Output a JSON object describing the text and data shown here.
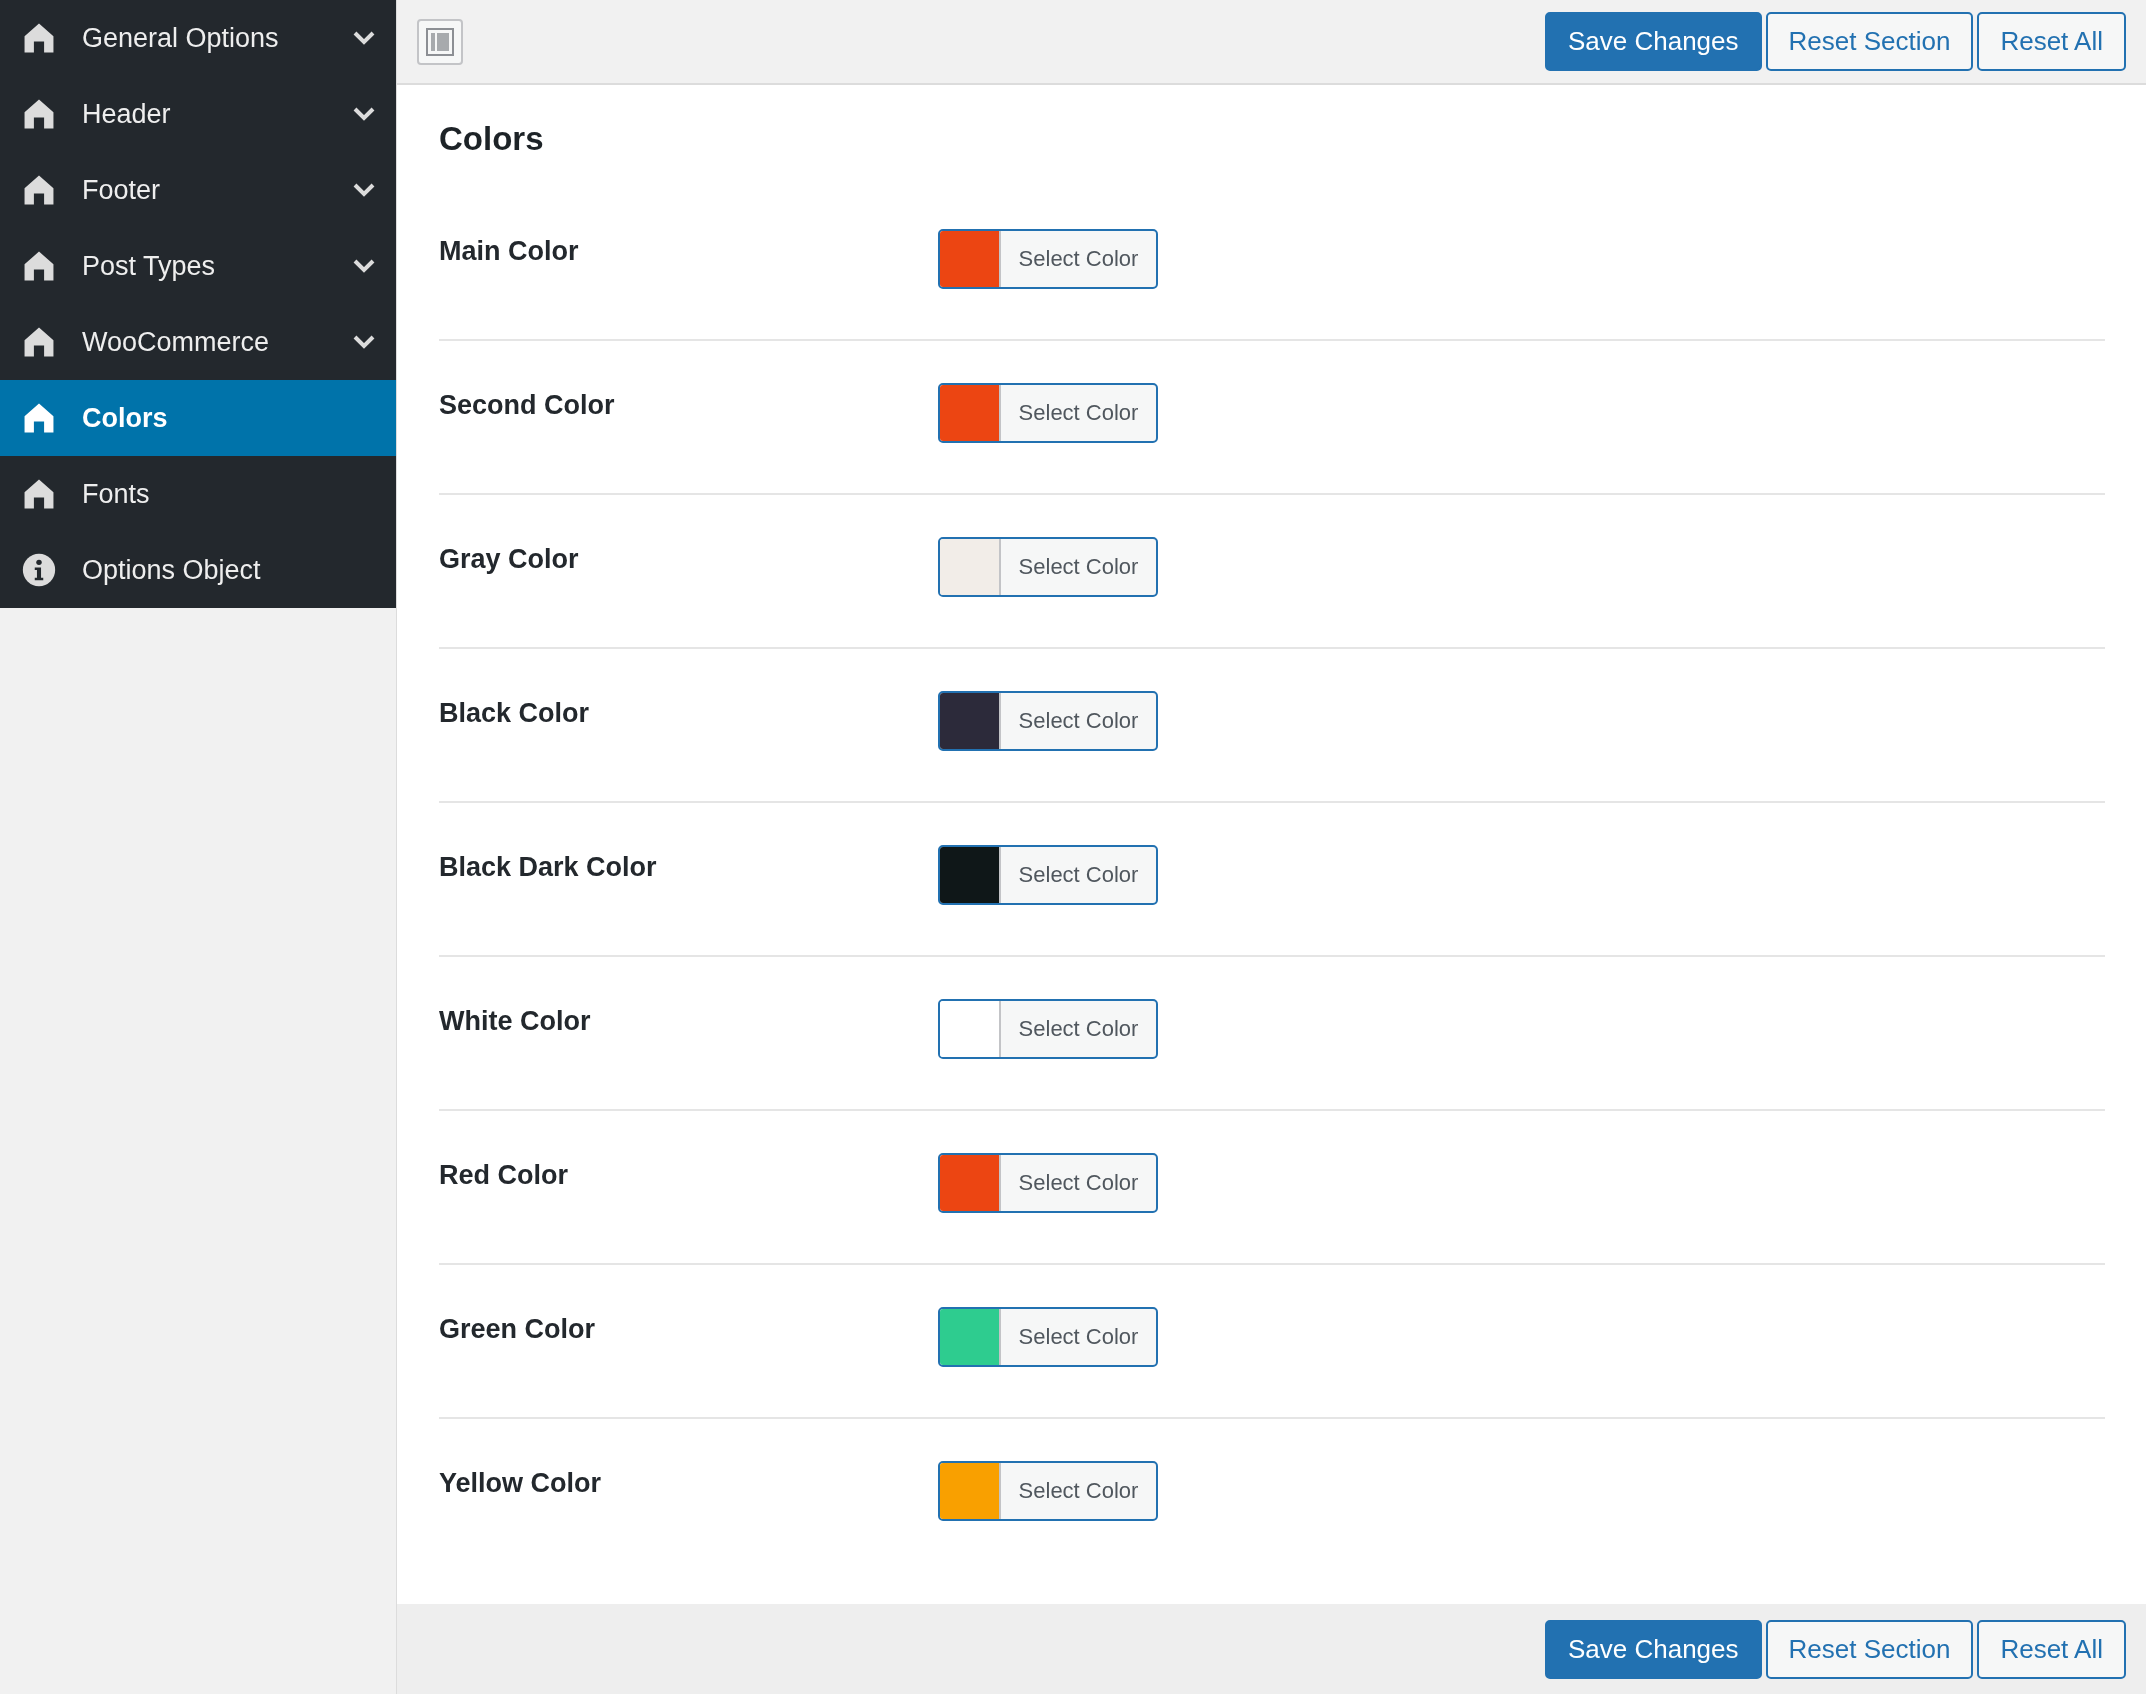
{
  "sidebar": {
    "items": [
      {
        "label": "General Options",
        "kind": "home",
        "has_submenu": true,
        "selected": false
      },
      {
        "label": "Header",
        "kind": "home",
        "has_submenu": true,
        "selected": false
      },
      {
        "label": "Footer",
        "kind": "home",
        "has_submenu": true,
        "selected": false
      },
      {
        "label": "Post Types",
        "kind": "home",
        "has_submenu": true,
        "selected": false
      },
      {
        "label": "WooCommerce",
        "kind": "home",
        "has_submenu": true,
        "selected": false
      },
      {
        "label": "Colors",
        "kind": "home",
        "has_submenu": false,
        "selected": true
      },
      {
        "label": "Fonts",
        "kind": "home",
        "has_submenu": false,
        "selected": false
      },
      {
        "label": "Options Object",
        "kind": "info",
        "has_submenu": false,
        "selected": false
      }
    ]
  },
  "top_buttons": [
    {
      "label": "Save Changes",
      "kind": "primary"
    },
    {
      "label": "Reset Section",
      "kind": "secondary"
    },
    {
      "label": "Reset All",
      "kind": "secondary"
    }
  ],
  "section": {
    "title": "Colors",
    "fields": [
      {
        "label": "Main Color",
        "color": "#ec4512",
        "button": "Select Color"
      },
      {
        "label": "Second Color",
        "color": "#ec4512",
        "button": "Select Color"
      },
      {
        "label": "Gray Color",
        "color": "#f2ede8",
        "button": "Select Color"
      },
      {
        "label": "Black Color",
        "color": "#2c2a3a",
        "button": "Select Color"
      },
      {
        "label": "Black Dark Color",
        "color": "#0f1718",
        "button": "Select Color"
      },
      {
        "label": "White Color",
        "color": "#ffffff",
        "button": "Select Color"
      },
      {
        "label": "Red Color",
        "color": "#ec4512",
        "button": "Select Color"
      },
      {
        "label": "Green Color",
        "color": "#2ecc8f",
        "button": "Select Color"
      },
      {
        "label": "Yellow Color",
        "color": "#f9a000",
        "button": "Select Color"
      }
    ]
  },
  "bottom_buttons": [
    {
      "label": "Save Changes",
      "kind": "primary"
    },
    {
      "label": "Reset Section",
      "kind": "secondary"
    },
    {
      "label": "Reset All",
      "kind": "secondary"
    }
  ]
}
